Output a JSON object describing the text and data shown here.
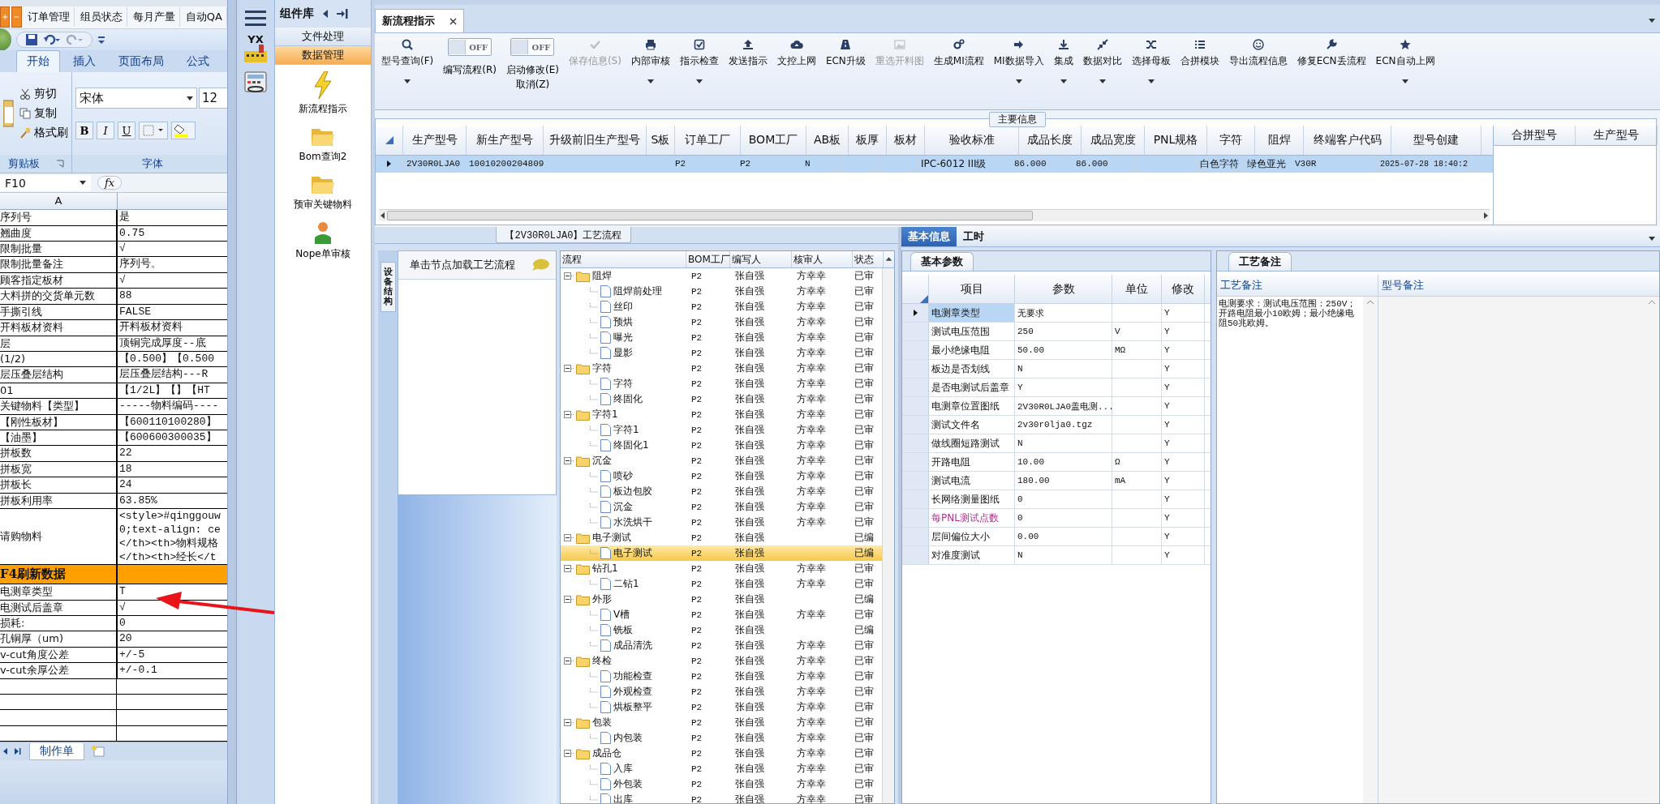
{
  "excel": {
    "app_tabs": [
      "订单管理",
      "组员状态",
      "每月产量",
      "自动QA"
    ],
    "ribbon_tabs": [
      {
        "label": "开始",
        "selected": true
      },
      {
        "label": "插入",
        "selected": false
      },
      {
        "label": "页面布局",
        "selected": false
      },
      {
        "label": "公式",
        "selected": false
      }
    ],
    "clipboard": {
      "items": [
        "剪切",
        "复制",
        "格式刷"
      ],
      "label": "剪贴板"
    },
    "font": {
      "name": "宋体",
      "size": "12",
      "buttons": [
        "B",
        "I",
        "U"
      ],
      "label": "字体"
    },
    "name_box": "F10",
    "fx": "fx",
    "column_header": "A",
    "rows": [
      {
        "kind": "normal",
        "a": "序列号",
        "b": "是"
      },
      {
        "kind": "normal",
        "a": "翘曲度",
        "b": "0.75"
      },
      {
        "kind": "normal",
        "a": "限制批量",
        "b": "√"
      },
      {
        "kind": "normal",
        "a": "限制批量备注",
        "b": "序列号。"
      },
      {
        "kind": "normal",
        "a": "顾客指定板材",
        "b": "√"
      },
      {
        "kind": "normal",
        "a": "大料拼的交货单元数",
        "b": "88"
      },
      {
        "kind": "normal",
        "a": "手撕引线",
        "b": "FALSE"
      },
      {
        "kind": "normal",
        "a": "开料板材资料",
        "b": "开料板材资料"
      },
      {
        "kind": "normal",
        "a": "层",
        "b": "顶铜完成厚度--底"
      },
      {
        "kind": "normal",
        "a": "(1/2)",
        "b": "【0.500】【0.500"
      },
      {
        "kind": "normal",
        "a": "层压叠层结构",
        "b": "层压叠层结构---R"
      },
      {
        "kind": "normal",
        "a": "01",
        "b": "【1/2L】【】【HT"
      },
      {
        "kind": "normal",
        "a": "关键物料【类型】",
        "b": "-----物料编码----"
      },
      {
        "kind": "normal",
        "a": "【刚性板材】",
        "b": "【600110100280】"
      },
      {
        "kind": "normal",
        "a": "【油墨】",
        "b": "【600600300035】"
      },
      {
        "kind": "normal",
        "a": "拼板数",
        "b": "22"
      },
      {
        "kind": "normal",
        "a": "拼板宽",
        "b": "18"
      },
      {
        "kind": "normal",
        "a": "拼板长",
        "b": "24"
      },
      {
        "kind": "normal",
        "a": "拼板利用率",
        "b": "63.85%"
      },
      {
        "kind": "multi",
        "a": "请购物料",
        "lines": [
          "<style>#qinggouw",
          "0;text-align: ce",
          "</th><th>物料规格",
          "</th><th>经长</t"
        ]
      },
      {
        "kind": "section",
        "a": "F4刷新数据",
        "b": ""
      },
      {
        "kind": "normal",
        "a": "电测章类型",
        "b": "T"
      },
      {
        "kind": "normal",
        "a": "电测试后盖章",
        "b": "√"
      },
      {
        "kind": "normal",
        "a": "损耗:",
        "b": "0"
      },
      {
        "kind": "normal",
        "a": "孔铜厚（um)",
        "b": "20"
      },
      {
        "kind": "normal",
        "a": "v-cut角度公差",
        "b": "+/-5"
      },
      {
        "kind": "normal",
        "a": "v-cut余厚公差",
        "b": "+/-0.1"
      }
    ],
    "sheet_tab": "制作单"
  },
  "sidebar": {
    "logo_text": "YX"
  },
  "components": {
    "title": "组件库",
    "sections": [
      {
        "label": "文件处理",
        "selected": false
      },
      {
        "label": "数据管理",
        "selected": true
      }
    ],
    "items": [
      "新流程指示",
      "Bom查询2",
      "预审关键物料",
      "Nope单审核"
    ]
  },
  "document_tab": {
    "title": "新流程指示"
  },
  "toolbar": [
    {
      "kind": "button",
      "label": "型号查询(F)",
      "dropdown": true,
      "disabled": false
    },
    {
      "kind": "toggle",
      "label": "编写流程(R)",
      "switch_text": "OFF",
      "on": false
    },
    {
      "kind": "toggle",
      "label": "启动修改(E)",
      "sublabel": "取消(Z)",
      "switch_text": "OFF",
      "on": false
    },
    {
      "kind": "button",
      "label": "保存信息(S)",
      "dropdown": false,
      "disabled": true
    },
    {
      "kind": "button",
      "label": "内部审核",
      "dropdown": true,
      "disabled": false
    },
    {
      "kind": "button",
      "label": "指示检查",
      "dropdown": true,
      "disabled": false
    },
    {
      "kind": "button",
      "label": "发送指示",
      "dropdown": false,
      "disabled": false
    },
    {
      "kind": "button",
      "label": "文控上网",
      "dropdown": false,
      "disabled": false
    },
    {
      "kind": "button",
      "label": "ECN升级",
      "dropdown": false,
      "disabled": false
    },
    {
      "kind": "button",
      "label": "重选开料图",
      "dropdown": false,
      "disabled": true
    },
    {
      "kind": "button",
      "label": "生成MI流程",
      "dropdown": false,
      "disabled": false
    },
    {
      "kind": "button",
      "label": "MI数据导入",
      "dropdown": true,
      "disabled": false
    },
    {
      "kind": "button",
      "label": "集成",
      "dropdown": true,
      "disabled": false
    },
    {
      "kind": "button",
      "label": "数据对比",
      "dropdown": true,
      "disabled": false
    },
    {
      "kind": "button",
      "label": "选择母板",
      "dropdown": true,
      "disabled": false
    },
    {
      "kind": "button",
      "label": "合拼模块",
      "dropdown": false,
      "disabled": false
    },
    {
      "kind": "button",
      "label": "导出流程信息",
      "dropdown": false,
      "disabled": false
    },
    {
      "kind": "button",
      "label": "修复ECN丢流程",
      "dropdown": false,
      "disabled": false
    },
    {
      "kind": "button",
      "label": "ECN自动上网",
      "dropdown": true,
      "disabled": false
    }
  ],
  "main_info": {
    "title": "主要信息",
    "columns": [
      "生产型号",
      "新生产型号",
      "升级前旧生产型号",
      "S板",
      "订单工厂",
      "BOM工厂",
      "AB板",
      "板厚",
      "板材",
      "验收标准",
      "成品长度",
      "成品宽度",
      "PNL规格",
      "字符",
      "阻焊",
      "终端客户代码",
      "型号创建"
    ],
    "rows": [
      {
        "selected": true,
        "cells": [
          "2V30R0LJA0",
          "10010200204809",
          "",
          "",
          "P2",
          "P2",
          "N",
          "",
          "",
          "IPC-6012 III级",
          "86.000",
          "86.000",
          "",
          "白色字符",
          "绿色亚光",
          "V30R",
          "2025-07-28 18:40:2"
        ]
      }
    ],
    "side_columns": [
      "合拼型号",
      "生产型号"
    ]
  },
  "flow": {
    "title": "【2V30R0LJA0】工艺流程",
    "side_tab": "设备结构",
    "hint": "单击节点加载工艺流程",
    "columns": [
      "流程",
      "BOM工厂",
      "编写人",
      "核审人",
      "状态"
    ],
    "tree": [
      {
        "name": "阻焊",
        "bom": "P2",
        "writer": "张自强",
        "reviewer": "方幸幸",
        "status": "已审",
        "selected": false,
        "expanded": true,
        "children": [
          {
            "name": "阻焊前处理",
            "bom": "P2",
            "writer": "张自强",
            "reviewer": "方幸幸",
            "status": "已审",
            "selected": false
          },
          {
            "name": "丝印",
            "bom": "P2",
            "writer": "张自强",
            "reviewer": "方幸幸",
            "status": "已审",
            "selected": false
          },
          {
            "name": "预烘",
            "bom": "P2",
            "writer": "张自强",
            "reviewer": "方幸幸",
            "status": "已审",
            "selected": false
          },
          {
            "name": "曝光",
            "bom": "P2",
            "writer": "张自强",
            "reviewer": "方幸幸",
            "status": "已审",
            "selected": false
          },
          {
            "name": "显影",
            "bom": "P2",
            "writer": "张自强",
            "reviewer": "方幸幸",
            "status": "已审",
            "selected": false
          }
        ]
      },
      {
        "name": "字符",
        "bom": "P2",
        "writer": "张自强",
        "reviewer": "方幸幸",
        "status": "已审",
        "selected": false,
        "expanded": true,
        "children": [
          {
            "name": "字符",
            "bom": "P2",
            "writer": "张自强",
            "reviewer": "方幸幸",
            "status": "已审",
            "selected": false
          },
          {
            "name": "终固化",
            "bom": "P2",
            "writer": "张自强",
            "reviewer": "方幸幸",
            "status": "已审",
            "selected": false
          }
        ]
      },
      {
        "name": "字符1",
        "bom": "P2",
        "writer": "张自强",
        "reviewer": "方幸幸",
        "status": "已审",
        "selected": false,
        "expanded": true,
        "children": [
          {
            "name": "字符1",
            "bom": "P2",
            "writer": "张自强",
            "reviewer": "方幸幸",
            "status": "已审",
            "selected": false
          },
          {
            "name": "终固化1",
            "bom": "P2",
            "writer": "张自强",
            "reviewer": "方幸幸",
            "status": "已审",
            "selected": false
          }
        ]
      },
      {
        "name": "沉金",
        "bom": "P2",
        "writer": "张自强",
        "reviewer": "方幸幸",
        "status": "已审",
        "selected": false,
        "expanded": true,
        "children": [
          {
            "name": "喷砂",
            "bom": "P2",
            "writer": "张自强",
            "reviewer": "方幸幸",
            "status": "已审",
            "selected": false
          },
          {
            "name": "板边包胶",
            "bom": "P2",
            "writer": "张自强",
            "reviewer": "方幸幸",
            "status": "已审",
            "selected": false
          },
          {
            "name": "沉金",
            "bom": "P2",
            "writer": "张自强",
            "reviewer": "方幸幸",
            "status": "已审",
            "selected": false
          },
          {
            "name": "水洗烘干",
            "bom": "P2",
            "writer": "张自强",
            "reviewer": "方幸幸",
            "status": "已审",
            "selected": false
          }
        ]
      },
      {
        "name": "电子测试",
        "bom": "P2",
        "writer": "张自强",
        "status": "已编",
        "selected": false,
        "expanded": true,
        "children": [
          {
            "name": "电子测试",
            "bom": "P2",
            "writer": "张自强",
            "status": "已编",
            "selected": true
          }
        ]
      },
      {
        "name": "钻孔1",
        "bom": "P2",
        "writer": "张自强",
        "reviewer": "方幸幸",
        "status": "已审",
        "selected": false,
        "expanded": true,
        "children": [
          {
            "name": "二钻1",
            "bom": "P2",
            "writer": "张自强",
            "reviewer": "方幸幸",
            "status": "已审",
            "selected": false
          }
        ]
      },
      {
        "name": "外形",
        "bom": "P2",
        "writer": "张自强",
        "status": "已编",
        "selected": false,
        "expanded": true,
        "children": [
          {
            "name": "V槽",
            "bom": "P2",
            "writer": "张自强",
            "reviewer": "方幸幸",
            "status": "已审",
            "selected": false
          },
          {
            "name": "铣板",
            "bom": "P2",
            "writer": "张自强",
            "status": "已编",
            "selected": false
          },
          {
            "name": "成品清洗",
            "bom": "P2",
            "writer": "张自强",
            "reviewer": "方幸幸",
            "status": "已审",
            "selected": false
          }
        ]
      },
      {
        "name": "终检",
        "bom": "P2",
        "writer": "张自强",
        "reviewer": "方幸幸",
        "status": "已审",
        "selected": false,
        "expanded": true,
        "children": [
          {
            "name": "功能检查",
            "bom": "P2",
            "writer": "张自强",
            "reviewer": "方幸幸",
            "status": "已审",
            "selected": false
          },
          {
            "name": "外观检查",
            "bom": "P2",
            "writer": "张自强",
            "reviewer": "方幸幸",
            "status": "已审",
            "selected": false
          },
          {
            "name": "烘板整平",
            "bom": "P2",
            "writer": "张自强",
            "reviewer": "方幸幸",
            "status": "已审",
            "selected": false
          }
        ]
      },
      {
        "name": "包装",
        "bom": "P2",
        "writer": "张自强",
        "reviewer": "方幸幸",
        "status": "已审",
        "selected": false,
        "expanded": true,
        "children": [
          {
            "name": "内包装",
            "bom": "P2",
            "writer": "张自强",
            "reviewer": "方幸幸",
            "status": "已审",
            "selected": false
          }
        ]
      },
      {
        "name": "成品仓",
        "bom": "P2",
        "writer": "张自强",
        "reviewer": "方幸幸",
        "status": "已审",
        "selected": false,
        "expanded": true,
        "children": [
          {
            "name": "入库",
            "bom": "P2",
            "writer": "张自强",
            "reviewer": "方幸幸",
            "status": "已审",
            "selected": false
          },
          {
            "name": "外包装",
            "bom": "P2",
            "writer": "张自强",
            "reviewer": "方幸幸",
            "status": "已审",
            "selected": false
          },
          {
            "name": "出库",
            "bom": "P2",
            "writer": "张自强",
            "reviewer": "方幸幸",
            "status": "已审",
            "selected": false
          }
        ]
      }
    ]
  },
  "detail_tabs": [
    {
      "label": "基本信息",
      "selected": true
    },
    {
      "label": "工时",
      "selected": false
    }
  ],
  "params": {
    "tab": "基本参数",
    "columns": [
      "项目",
      "参数",
      "单位",
      "修改"
    ],
    "rows": [
      {
        "item": "电测章类型",
        "value": "无要求",
        "modify": "Y",
        "selected": true,
        "highlighted": false
      },
      {
        "item": "测试电压范围",
        "value": "250",
        "unit": "V",
        "modify": "Y",
        "selected": false,
        "highlighted": false
      },
      {
        "item": "最小绝缘电阻",
        "value": "50.00",
        "unit": "MΩ",
        "modify": "Y",
        "selected": false,
        "highlighted": false
      },
      {
        "item": "板边是否划线",
        "value": "N",
        "modify": "Y",
        "selected": false,
        "highlighted": false
      },
      {
        "item": "是否电测试后盖章",
        "value": "Y",
        "modify": "Y",
        "selected": false,
        "highlighted": false
      },
      {
        "item": "电测章位置图纸",
        "value": "2V30R0LJA0盖电测...",
        "modify": "Y",
        "selected": false,
        "highlighted": false
      },
      {
        "item": "测试文件名",
        "value": "2v30r0lja0.tgz",
        "modify": "Y",
        "selected": false,
        "highlighted": false
      },
      {
        "item": "做线圈短路测试",
        "value": "N",
        "modify": "Y",
        "selected": false,
        "highlighted": false
      },
      {
        "item": "开路电阻",
        "value": "10.00",
        "unit": "Ω",
        "modify": "Y",
        "selected": false,
        "highlighted": false
      },
      {
        "item": "测试电流",
        "value": "180.00",
        "unit": "mA",
        "modify": "Y",
        "selected": false,
        "highlighted": false
      },
      {
        "item": "长网络测量图纸",
        "value": "0",
        "modify": "Y",
        "selected": false,
        "highlighted": false
      },
      {
        "item": "每PNL测试点数",
        "value": "0",
        "modify": "Y",
        "selected": false,
        "highlighted": true
      },
      {
        "item": "层间偏位大小",
        "value": "0.00",
        "modify": "Y",
        "selected": false,
        "highlighted": false
      },
      {
        "item": "对准度测试",
        "value": "N",
        "modify": "Y",
        "selected": false,
        "highlighted": false
      }
    ]
  },
  "notes": {
    "tab": "工艺备注",
    "columns": [
      "工艺备注",
      "型号备注"
    ],
    "process_note": "电测要求：测试电压范围：250V；开路电阻最小10欧姆；最小绝缘电阻50兆欧姆。"
  }
}
